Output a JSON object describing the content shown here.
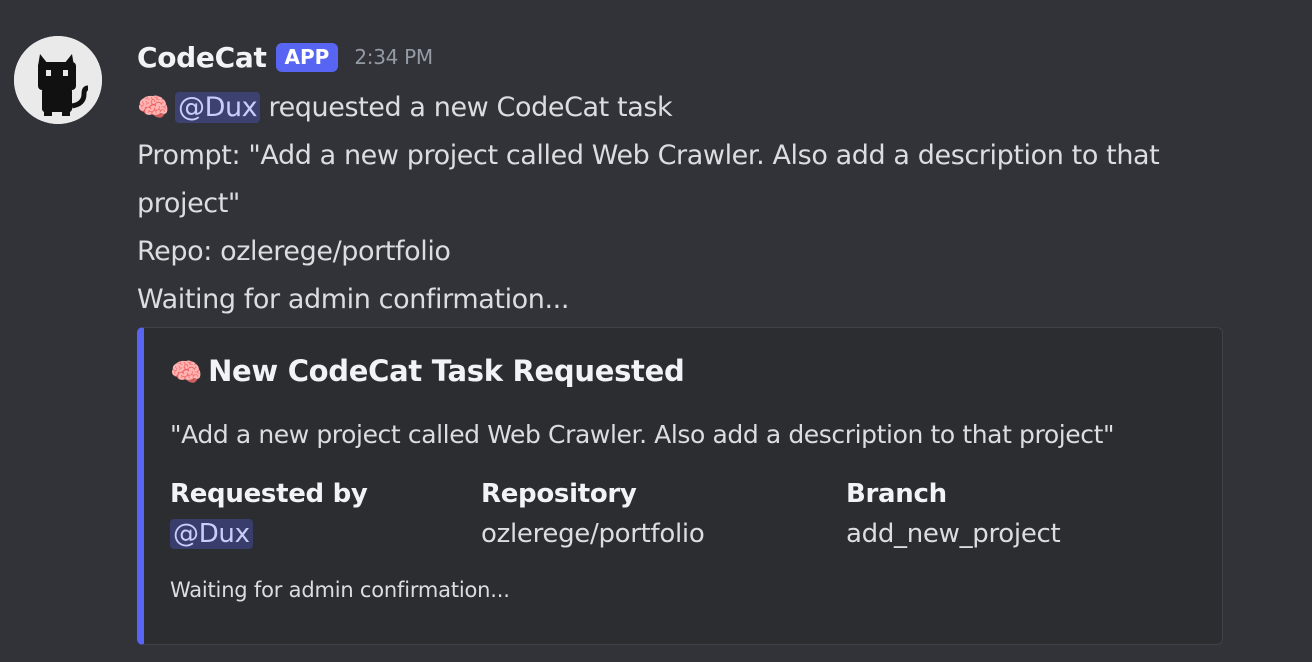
{
  "message": {
    "author": "CodeCat",
    "badge": "APP",
    "timestamp": "2:34 PM",
    "emoji": "🧠",
    "mention": "@Dux",
    "request_text": "requested a new CodeCat task",
    "prompt_line_1": "Prompt: \"Add a new project called Web Crawler. Also add a description to that",
    "prompt_line_2": "project\"",
    "repo_line": "Repo: ozlerege/portfolio",
    "waiting_line": "Waiting for admin confirmation..."
  },
  "embed": {
    "accent_color": "#5865f2",
    "title_emoji": "🧠",
    "title": "New CodeCat Task Requested",
    "description": "\"Add a new project called Web Crawler. Also add a description to that project\"",
    "fields": [
      {
        "name": "Requested by",
        "value": "@Dux"
      },
      {
        "name": "Repository",
        "value": "ozlerege/portfolio"
      },
      {
        "name": "Branch",
        "value": "add_new_project"
      }
    ],
    "footer": "Waiting for admin confirmation..."
  },
  "icons": {
    "avatar": "black-cat-icon",
    "emoji": "brain-icon"
  }
}
